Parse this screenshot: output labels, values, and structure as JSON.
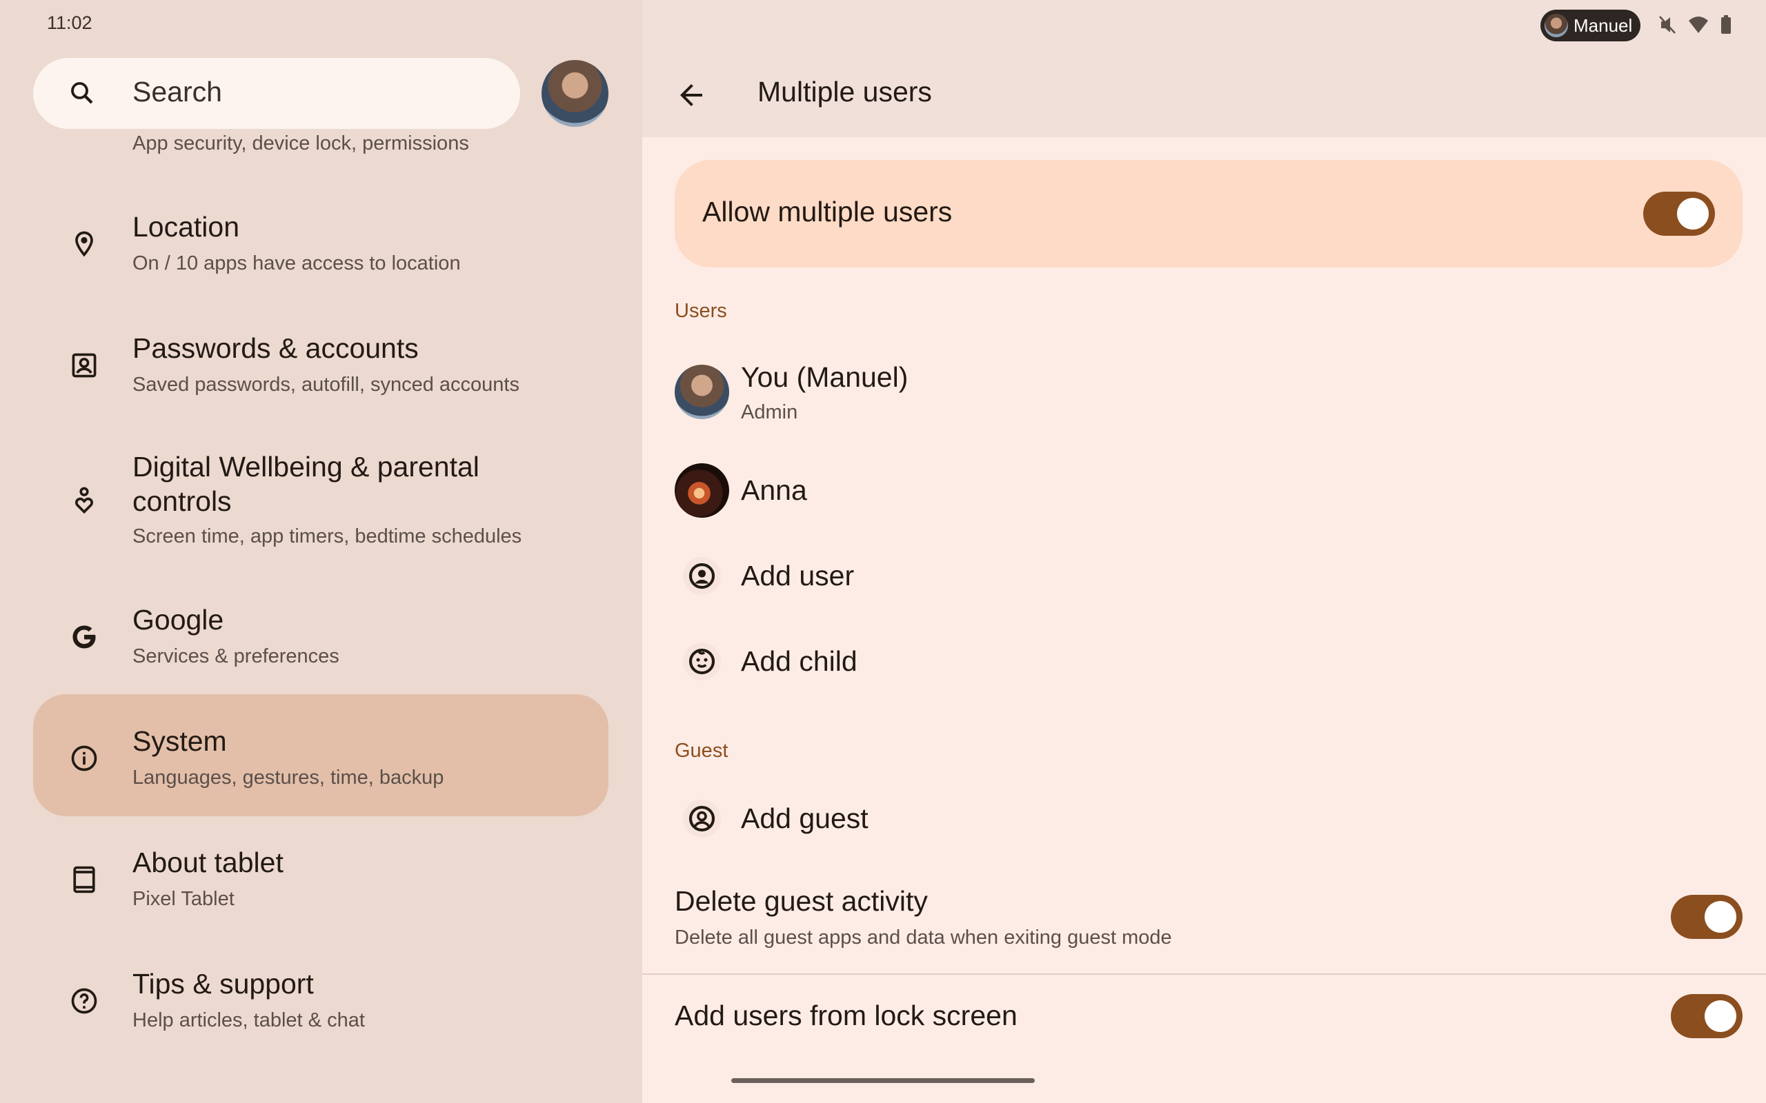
{
  "status_bar": {
    "time": "11:02",
    "user_chip": "Manuel",
    "icons": [
      "mute-icon",
      "wifi-icon",
      "battery-icon"
    ]
  },
  "search": {
    "label": "Search"
  },
  "settings_list": [
    {
      "title": "",
      "subtitle": "App security, device lock, permissions"
    },
    {
      "title": "Location",
      "subtitle": "On / 10 apps have access to location",
      "icon": "location-pin-icon"
    },
    {
      "title": "Passwords & accounts",
      "subtitle": "Saved passwords, autofill, synced accounts",
      "icon": "account-box-icon"
    },
    {
      "title_line1": "Digital Wellbeing & parental",
      "title_line2": "controls",
      "subtitle": "Screen time, app timers, bedtime schedules",
      "icon": "wellbeing-icon"
    },
    {
      "title": "Google",
      "subtitle": "Services & preferences",
      "icon": "google-icon"
    },
    {
      "title": "System",
      "subtitle": "Languages, gestures, time, backup",
      "icon": "info-icon",
      "selected": true
    },
    {
      "title": "About tablet",
      "subtitle": "Pixel Tablet",
      "icon": "tablet-icon"
    },
    {
      "title": "Tips & support",
      "subtitle": "Help articles, tablet & chat",
      "icon": "help-icon"
    }
  ],
  "detail": {
    "title": "Multiple users",
    "allow_multiple_users": {
      "label": "Allow multiple users",
      "enabled": true
    },
    "users_header": "Users",
    "users": [
      {
        "name": "You (Manuel)",
        "role": "Admin"
      },
      {
        "name": "Anna"
      }
    ],
    "add_user": "Add user",
    "add_child": "Add child",
    "guest_header": "Guest",
    "add_guest": "Add guest",
    "delete_guest_activity": {
      "title": "Delete guest activity",
      "subtitle": "Delete all guest apps and data when exiting guest mode",
      "enabled": true
    },
    "add_from_lock_screen": {
      "title": "Add users from lock screen",
      "enabled": true
    }
  },
  "colors": {
    "accent": "#8b4e1f",
    "left_bg": "#ecd9d0",
    "right_bg": "#fdece5",
    "selected_item": "#e3bfa9",
    "allow_card": "#fedbc6"
  }
}
